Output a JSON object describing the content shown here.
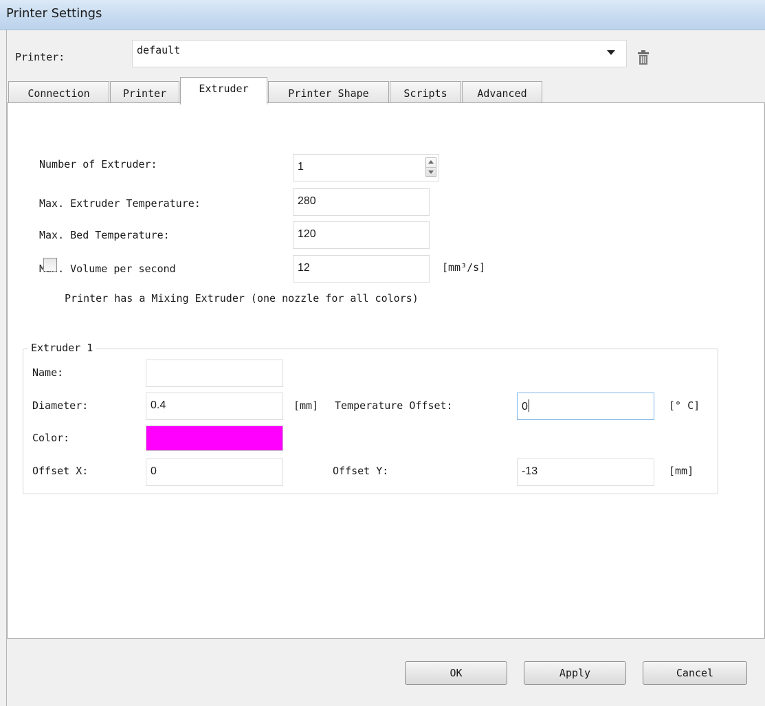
{
  "window": {
    "title": "Printer Settings"
  },
  "printer": {
    "label": "Printer:",
    "value": "default"
  },
  "tabs": [
    {
      "label": "Connection",
      "active": false
    },
    {
      "label": "Printer",
      "active": false
    },
    {
      "label": "Extruder",
      "active": true
    },
    {
      "label": "Printer Shape",
      "active": false
    },
    {
      "label": "Scripts",
      "active": false
    },
    {
      "label": "Advanced",
      "active": false
    }
  ],
  "extruder": {
    "num_extruders": {
      "label": "Number of Extruder:",
      "value": "1"
    },
    "max_extruder_temp": {
      "label": "Max. Extruder Temperature:",
      "value": "280"
    },
    "max_bed_temp": {
      "label": "Max. Bed Temperature:",
      "value": "120"
    },
    "max_volume": {
      "label": "Max. Volume per second",
      "value": "12",
      "unit": "[mm³/s]"
    },
    "mixing": {
      "label": "Printer has a Mixing Extruder (one nozzle for all colors)",
      "checked": false
    }
  },
  "group": {
    "title": "Extruder 1",
    "name": {
      "label": "Name:",
      "value": ""
    },
    "diameter": {
      "label": "Diameter:",
      "value": "0.4",
      "unit": "[mm]"
    },
    "temp_offset": {
      "label": "Temperature Offset:",
      "value": "0",
      "unit": "[° C]"
    },
    "color": {
      "label": "Color:",
      "value": "#ff00ff"
    },
    "offset_x": {
      "label": "Offset X:",
      "value": "0"
    },
    "offset_y": {
      "label": "Offset Y:",
      "value": "-13",
      "unit": "[mm]"
    }
  },
  "buttons": {
    "ok": "OK",
    "apply": "Apply",
    "cancel": "Cancel"
  },
  "icons": {
    "dropdown": "chevron-down-icon",
    "delete": "trash-icon",
    "spinner": "spinner-arrows-icon"
  }
}
